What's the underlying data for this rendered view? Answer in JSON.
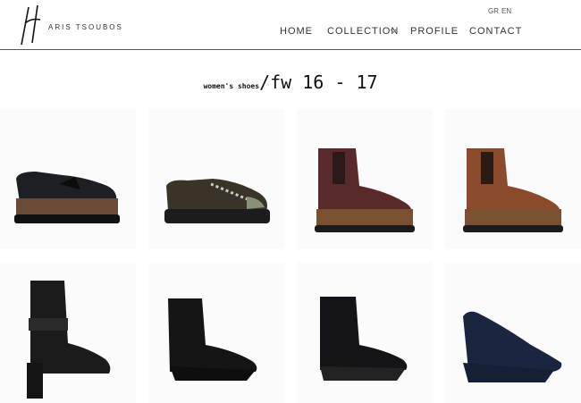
{
  "brand": {
    "name": "ARIS TSOUBOS"
  },
  "languages": [
    "GR",
    "EN"
  ],
  "nav": {
    "home": "HOME",
    "collection": "COLLECTION",
    "profile": "PROFILE",
    "contact": "CONTACT"
  },
  "heading": {
    "category": "women's shoes",
    "slash": "/",
    "season": "fw 16 - 17"
  },
  "products": [
    {
      "color": "#1c1f24",
      "sole": "#6b4a36",
      "style": "loafer",
      "icon": "platform-loafer"
    },
    {
      "color": "#3a3328",
      "sole": "#1c1c1c",
      "style": "sneaker",
      "icon": "platform-lace-up"
    },
    {
      "color": "#5a2a2a",
      "sole": "#7a5030",
      "style": "chelsea",
      "icon": "burgundy-chelsea-boot"
    },
    {
      "color": "#8b4a2b",
      "sole": "#7a5030",
      "style": "chelsea",
      "icon": "tan-chelsea-boot"
    },
    {
      "color": "#1b1b1b",
      "sole": "#1b1b1b",
      "style": "heelboot",
      "icon": "block-heel-boot"
    },
    {
      "color": "#151515",
      "sole": "#151515",
      "style": "wedgeboot",
      "icon": "wedge-chelsea-boot"
    },
    {
      "color": "#141418",
      "sole": "#222",
      "style": "wedgebootie",
      "icon": "wedge-suede-bootie"
    },
    {
      "color": "#1a2640",
      "sole": "#1a2640",
      "style": "wedgepump",
      "icon": "navy-wedge-pump"
    }
  ]
}
